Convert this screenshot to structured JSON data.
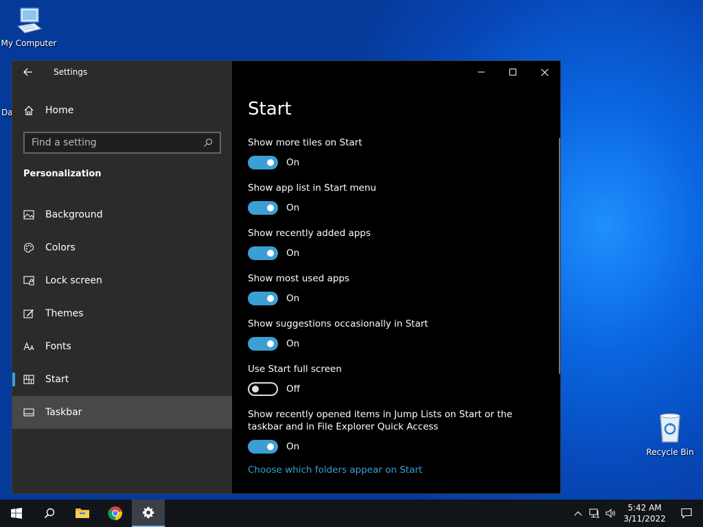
{
  "desktop": {
    "icons": [
      {
        "label": "My Computer"
      },
      {
        "label": "Recycle Bin"
      }
    ],
    "partial_label": "Da"
  },
  "window": {
    "app_title": "Settings",
    "sidebar": {
      "home_label": "Home",
      "search_placeholder": "Find a setting",
      "section_title": "Personalization",
      "items": [
        {
          "label": "Background",
          "icon": "background-icon"
        },
        {
          "label": "Colors",
          "icon": "colors-icon"
        },
        {
          "label": "Lock screen",
          "icon": "lock-screen-icon"
        },
        {
          "label": "Themes",
          "icon": "themes-icon"
        },
        {
          "label": "Fonts",
          "icon": "fonts-icon"
        },
        {
          "label": "Start",
          "icon": "start-icon",
          "selected": true
        },
        {
          "label": "Taskbar",
          "icon": "taskbar-icon",
          "hovered": true
        }
      ]
    },
    "content": {
      "page_title": "Start",
      "settings": [
        {
          "label": "Show more tiles on Start",
          "state": "On"
        },
        {
          "label": "Show app list in Start menu",
          "state": "On"
        },
        {
          "label": "Show recently added apps",
          "state": "On"
        },
        {
          "label": "Show most used apps",
          "state": "On"
        },
        {
          "label": "Show suggestions occasionally in Start",
          "state": "On"
        },
        {
          "label": "Use Start full screen",
          "state": "Off"
        },
        {
          "label": "Show recently opened items in Jump Lists on Start or the taskbar and in File Explorer Quick Access",
          "state": "On"
        }
      ],
      "link": "Choose which folders appear on Start"
    }
  },
  "taskbar": {
    "buttons": [
      "start-button",
      "search-button",
      "file-explorer-button",
      "chrome-button",
      "settings-button"
    ],
    "clock_time": "5:42 AM",
    "clock_date": "3/11/2022"
  },
  "colors": {
    "accent": "#3b9fd4",
    "sidebar_bg": "#2b2b2b",
    "content_bg": "#000000",
    "taskbar_bg": "#111419"
  }
}
